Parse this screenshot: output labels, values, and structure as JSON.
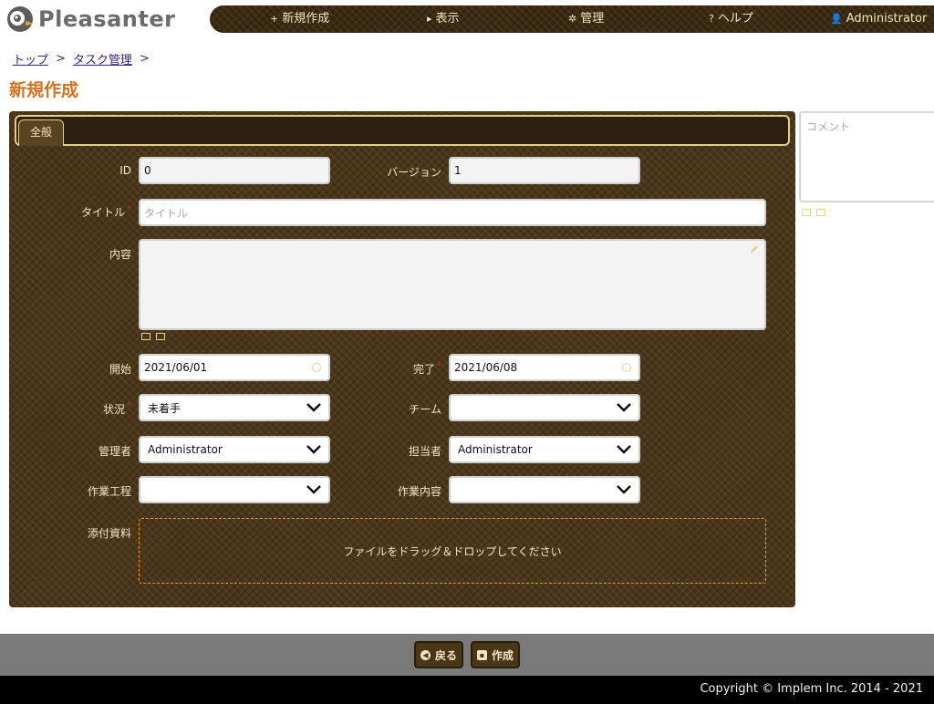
{
  "header": {
    "logo_text": "Pleasanter",
    "nav": [
      {
        "label": "新規作成",
        "icon": "+"
      },
      {
        "label": "表示",
        "icon": "▸"
      },
      {
        "label": "管理",
        "icon": "✲"
      },
      {
        "label": "ヘルプ",
        "icon": "?"
      },
      {
        "label": "Administrator",
        "icon": "👤"
      }
    ]
  },
  "breadcrumb": {
    "items": [
      "トップ",
      "タスク管理"
    ],
    "separator": ">"
  },
  "page_title": "新規作成",
  "tabs": [
    {
      "label": "全般"
    }
  ],
  "form": {
    "id": {
      "label": "ID",
      "value": "0"
    },
    "version": {
      "label": "バージョン",
      "value": "1"
    },
    "title": {
      "label": "タイトル",
      "placeholder": "タイトル"
    },
    "body": {
      "label": "内容"
    },
    "start": {
      "label": "開始",
      "value": "2021/06/01"
    },
    "complete": {
      "label": "完了",
      "value": "2021/06/08"
    },
    "status": {
      "label": "状況",
      "value": "未着手"
    },
    "team": {
      "label": "チーム",
      "value": ""
    },
    "manager": {
      "label": "管理者",
      "value": "Administrator"
    },
    "owner": {
      "label": "担当者",
      "value": "Administrator"
    },
    "process": {
      "label": "作業工程",
      "value": ""
    },
    "work": {
      "label": "作業内容",
      "value": ""
    },
    "attachments": {
      "label": "添付資料",
      "dropzone_text": "ファイルをドラッグ＆ドロップしてください"
    }
  },
  "comment": {
    "placeholder": "コメント"
  },
  "footer": {
    "back_label": "戻る",
    "create_label": "作成",
    "copyright": "Copyright © Implem Inc. 2014 - 2021"
  },
  "colors": {
    "accent": "#d9701f",
    "panel": "#4a3618",
    "label": "#f3e6c3"
  }
}
